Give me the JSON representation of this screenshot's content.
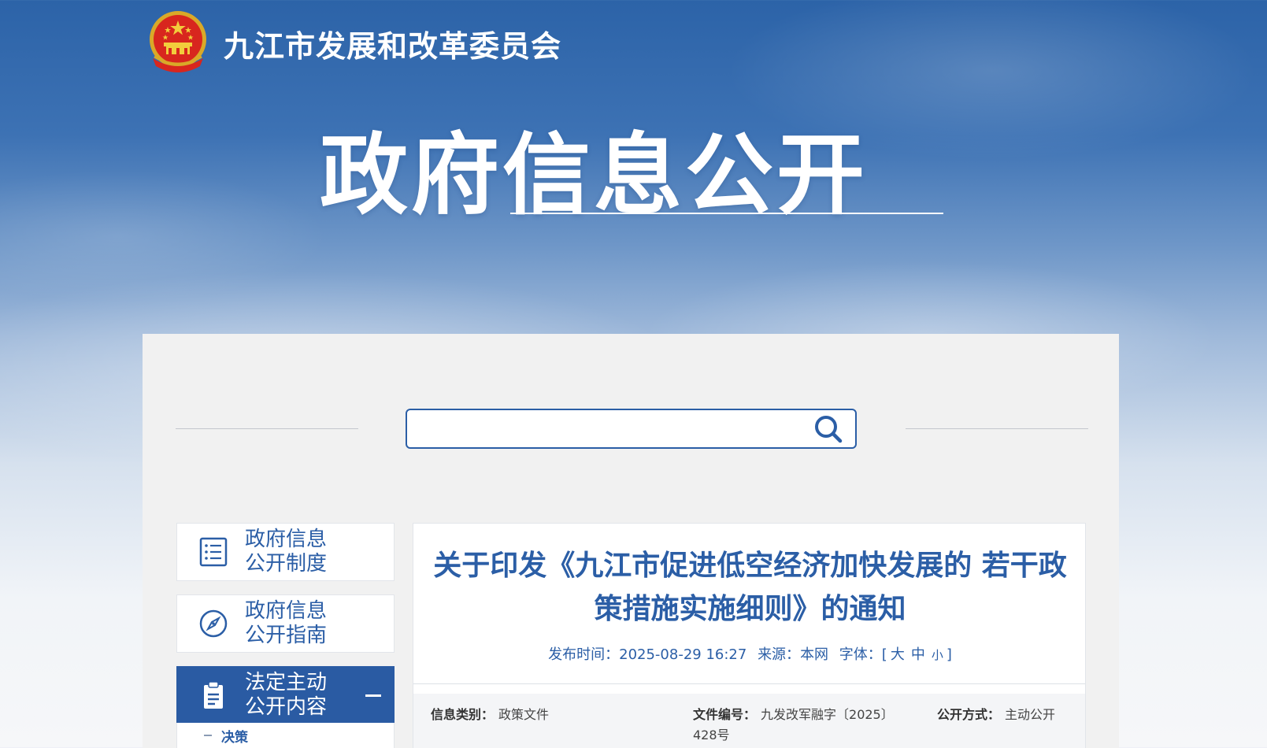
{
  "header": {
    "org_name": "九江市发展和改革委员会",
    "banner_title": "政府信息公开"
  },
  "search": {
    "placeholder": "",
    "value": ""
  },
  "sidebar": {
    "items": [
      {
        "label": "政府信息公开制度",
        "icon": "list-icon"
      },
      {
        "label": "政府信息公开指南",
        "icon": "compass-icon"
      },
      {
        "label": "法定主动公开内容",
        "icon": "clipboard-icon",
        "active": true,
        "expanded": true
      }
    ],
    "sub_items": [
      {
        "label": "决策"
      }
    ]
  },
  "article": {
    "title": "关于印发《九江市促进低空经济加快发展的 若干政策措施实施细则》的通知",
    "publish_label": "发布时间：",
    "publish_time": "2025-08-29 16:27",
    "source_label": "来源：",
    "source": "本网",
    "font_label": "字体：",
    "font_open": "[",
    "font_large": "大",
    "font_medium": "中",
    "font_small": "小",
    "font_close": "]",
    "info": {
      "category_label": "信息类别：",
      "category": "政策文件",
      "doc_no_label": "文件编号：",
      "doc_no": "九发改军融字〔2025〕428号",
      "mode_label": "公开方式：",
      "mode": "主动公开"
    }
  },
  "colors": {
    "primary": "#2b5ea6",
    "sidebar_active": "#2a5ba3",
    "panel_bg": "#f1f1f1"
  }
}
